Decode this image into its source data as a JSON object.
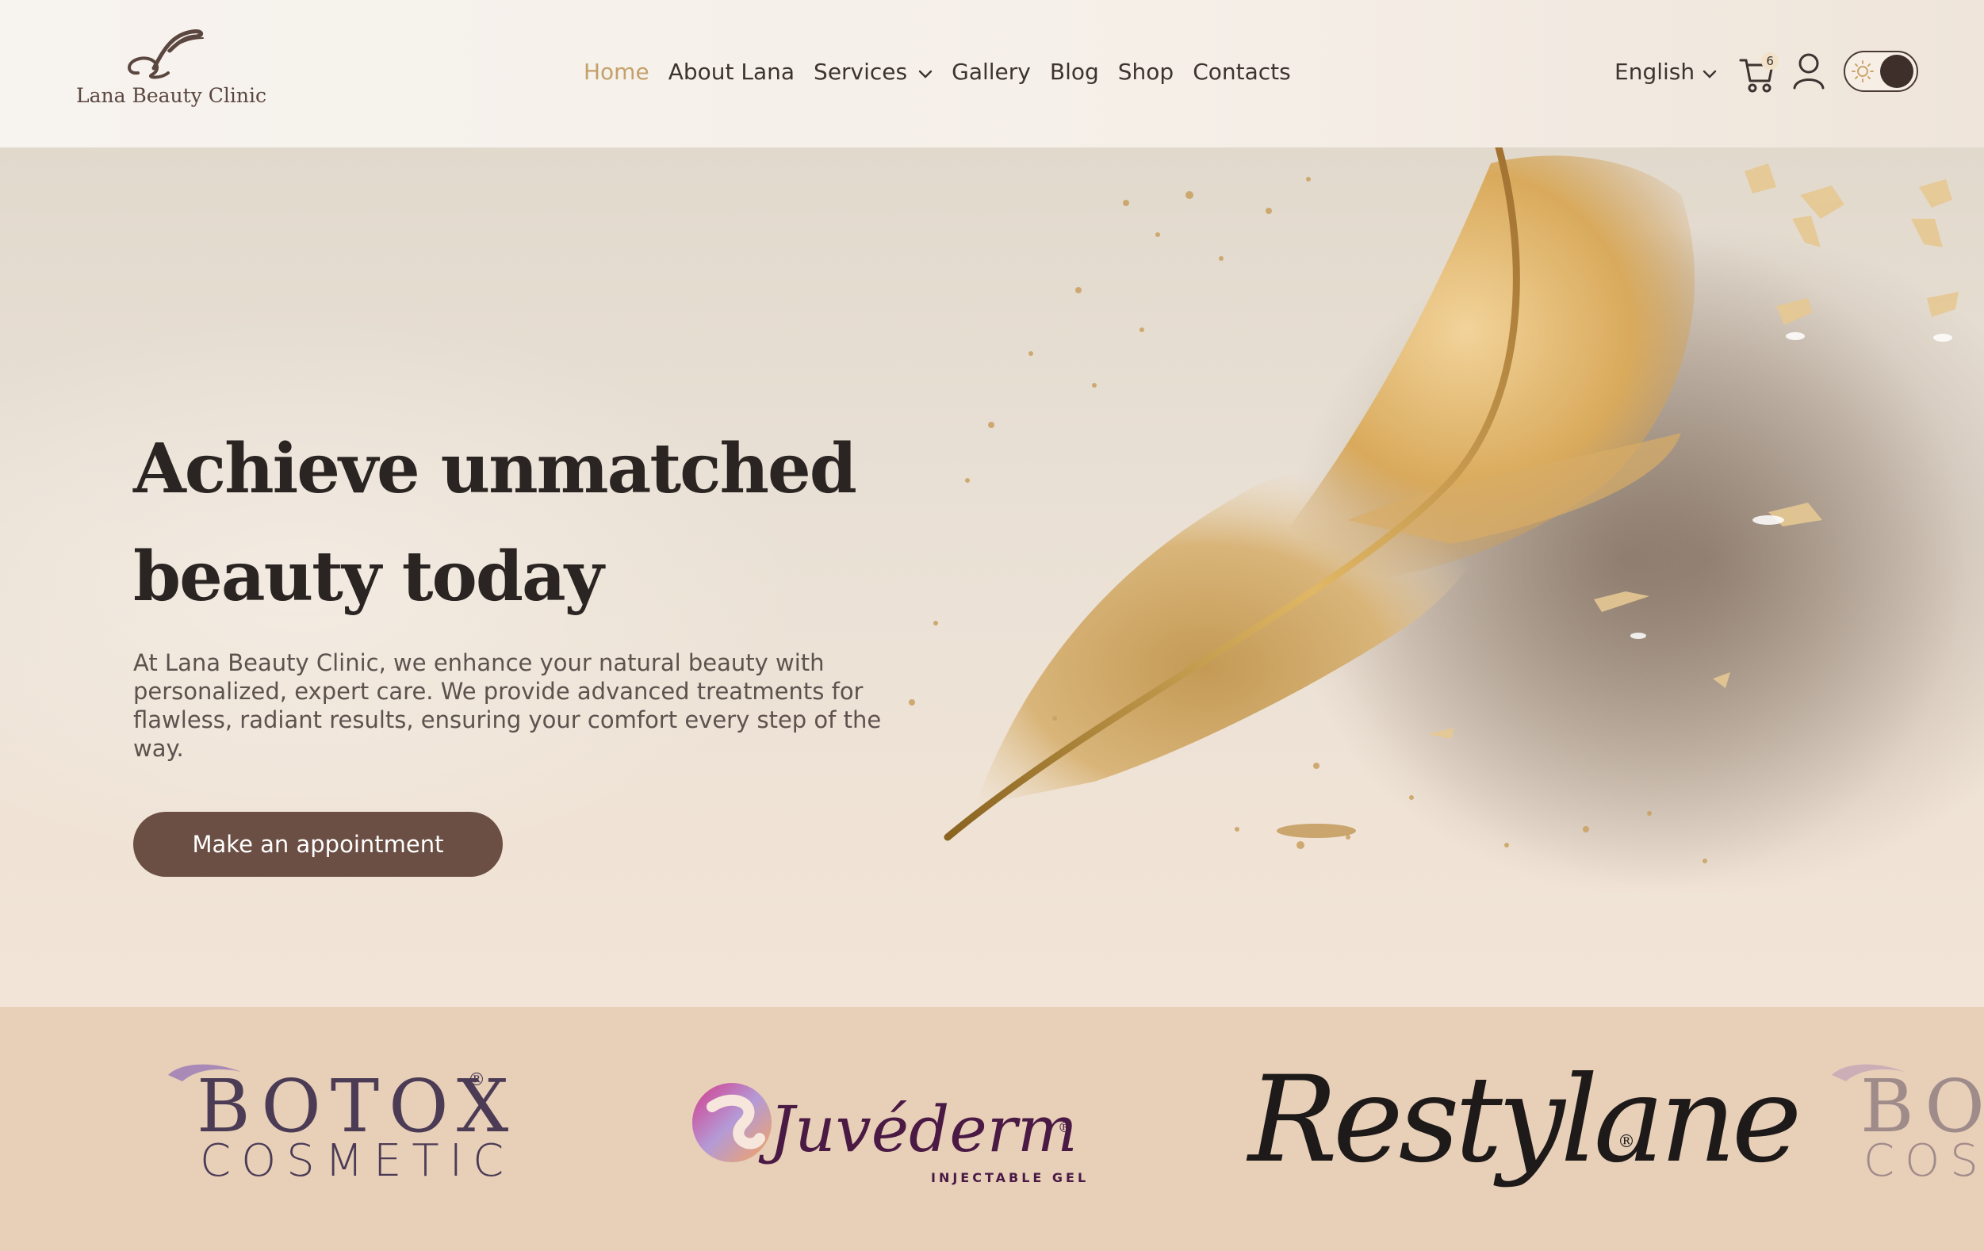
{
  "brand": {
    "name": "Lana Beauty Clinic",
    "accent_color": "#c4a06a",
    "primary_color": "#6b4f45",
    "dark_color": "#3f2f2b"
  },
  "nav": {
    "items": [
      {
        "label": "Home",
        "active": true
      },
      {
        "label": "About Lana",
        "active": false
      },
      {
        "label": "Services",
        "active": false,
        "has_dropdown": true
      },
      {
        "label": "Gallery",
        "active": false
      },
      {
        "label": "Blog",
        "active": false
      },
      {
        "label": "Shop",
        "active": false
      },
      {
        "label": "Contacts",
        "active": false
      }
    ]
  },
  "tools": {
    "language": "English",
    "cart_count": "6",
    "cart_icon": "cart-icon",
    "user_icon": "user-icon",
    "theme_toggle_icon": "sun-icon"
  },
  "hero": {
    "title_line1": "Achieve unmatched",
    "title_line2": "beauty today",
    "description": "At Lana Beauty Clinic, we enhance your natural beauty with personalized, expert care. We provide advanced treatments for flawless, radiant results, ensuring your comfort every step of the way.",
    "cta_label": "Make an appointment"
  },
  "partners": {
    "botox_top": "BOTOX",
    "botox_registered": "®",
    "botox_bottom": "COSMETIC",
    "juvederm": "Juvéderm",
    "juvederm_registered": "®",
    "juvederm_sub": "INJECTABLE GEL",
    "restylane": "Restylane",
    "restylane_registered": "®"
  }
}
